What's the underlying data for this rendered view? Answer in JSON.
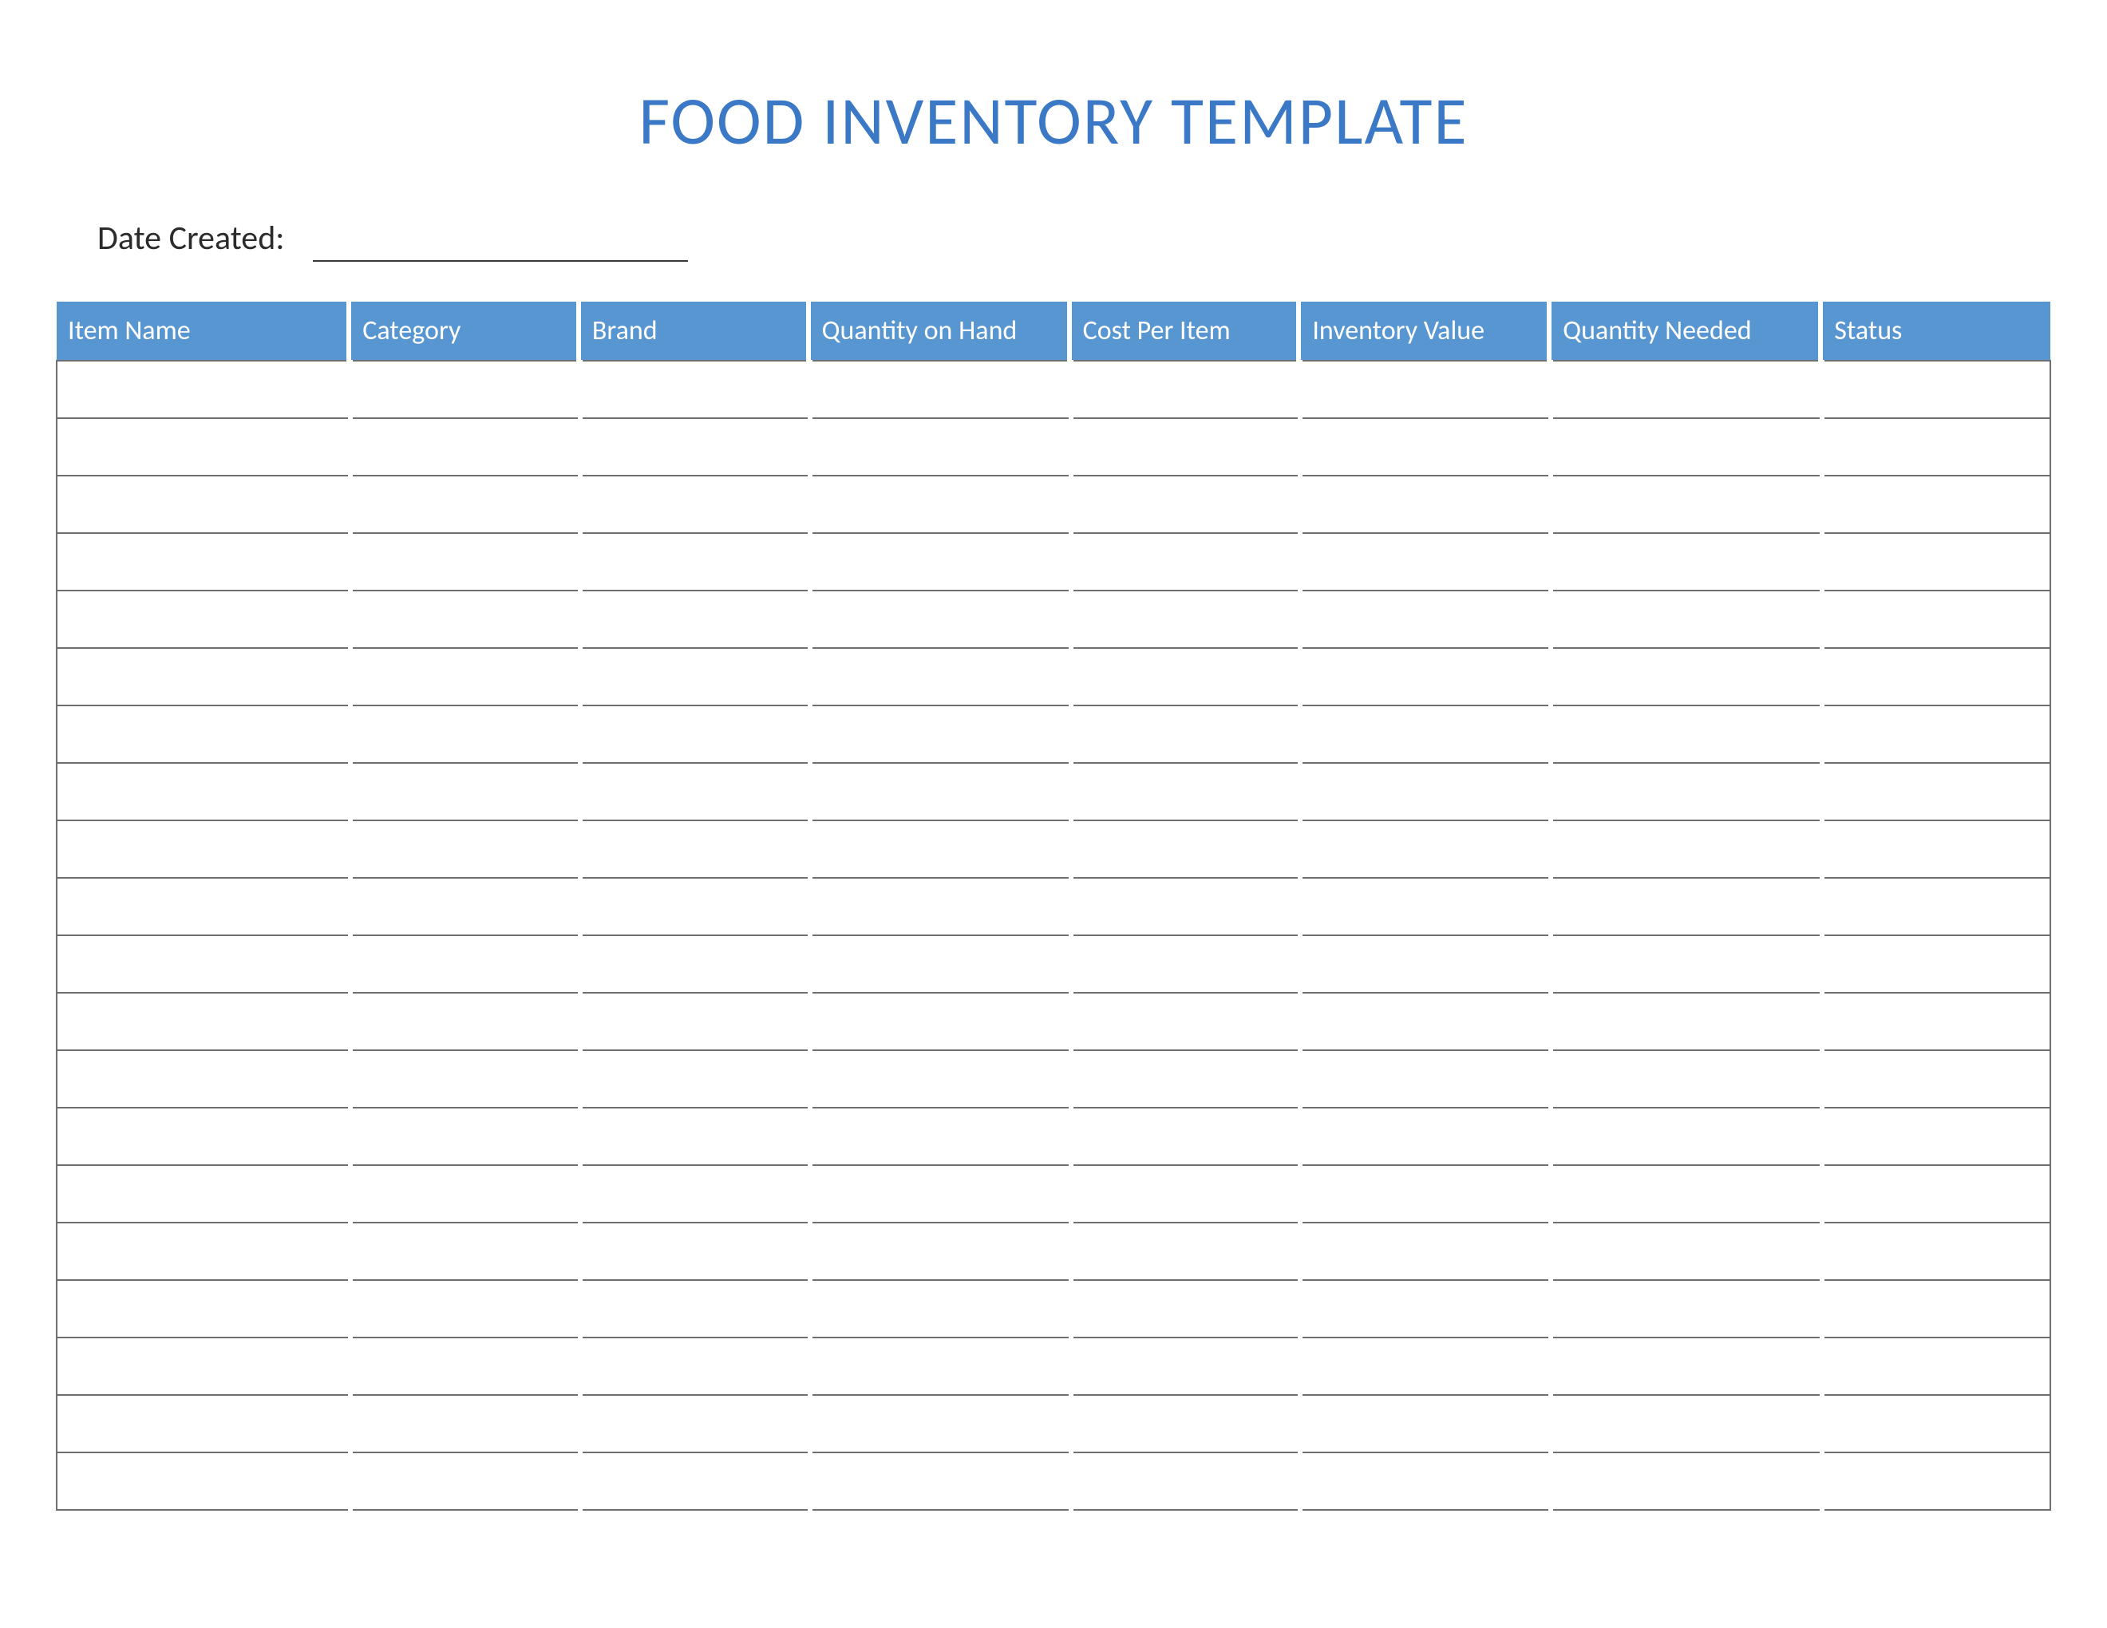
{
  "title": "FOOD INVENTORY TEMPLATE",
  "date_label": "Date Created:",
  "date_value": "",
  "columns": [
    "Item Name",
    "Category",
    "Brand",
    "Quantity on Hand",
    "Cost Per Item",
    "Inventory Value",
    "Quantity Needed",
    "Status"
  ],
  "rows": [
    [
      "",
      "",
      "",
      "",
      "",
      "",
      "",
      ""
    ],
    [
      "",
      "",
      "",
      "",
      "",
      "",
      "",
      ""
    ],
    [
      "",
      "",
      "",
      "",
      "",
      "",
      "",
      ""
    ],
    [
      "",
      "",
      "",
      "",
      "",
      "",
      "",
      ""
    ],
    [
      "",
      "",
      "",
      "",
      "",
      "",
      "",
      ""
    ],
    [
      "",
      "",
      "",
      "",
      "",
      "",
      "",
      ""
    ],
    [
      "",
      "",
      "",
      "",
      "",
      "",
      "",
      ""
    ],
    [
      "",
      "",
      "",
      "",
      "",
      "",
      "",
      ""
    ],
    [
      "",
      "",
      "",
      "",
      "",
      "",
      "",
      ""
    ],
    [
      "",
      "",
      "",
      "",
      "",
      "",
      "",
      ""
    ],
    [
      "",
      "",
      "",
      "",
      "",
      "",
      "",
      ""
    ],
    [
      "",
      "",
      "",
      "",
      "",
      "",
      "",
      ""
    ],
    [
      "",
      "",
      "",
      "",
      "",
      "",
      "",
      ""
    ],
    [
      "",
      "",
      "",
      "",
      "",
      "",
      "",
      ""
    ],
    [
      "",
      "",
      "",
      "",
      "",
      "",
      "",
      ""
    ],
    [
      "",
      "",
      "",
      "",
      "",
      "",
      "",
      ""
    ],
    [
      "",
      "",
      "",
      "",
      "",
      "",
      "",
      ""
    ],
    [
      "",
      "",
      "",
      "",
      "",
      "",
      "",
      ""
    ],
    [
      "",
      "",
      "",
      "",
      "",
      "",
      "",
      ""
    ],
    [
      "",
      "",
      "",
      "",
      "",
      "",
      "",
      ""
    ]
  ],
  "colors": {
    "header_bg": "#5896d2",
    "title_color": "#3b78c6",
    "cell_border": "#6f6f6f"
  }
}
